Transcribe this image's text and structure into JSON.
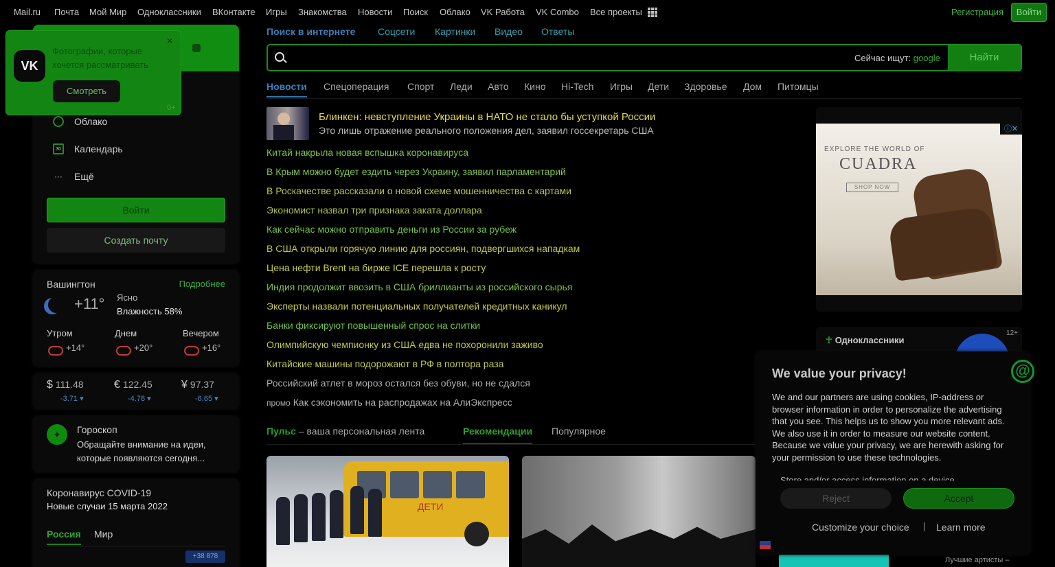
{
  "topnav": {
    "links": [
      "Mail.ru",
      "Почта",
      "Мой Мир",
      "Одноклассники",
      "ВКонтакте",
      "Игры",
      "Знакомства",
      "Новости",
      "Поиск",
      "Облако",
      "VK Работа",
      "VK Combo",
      "Все проекты"
    ],
    "register": "Регистрация",
    "login": "Войти"
  },
  "vk_popup": {
    "logo": "VK",
    "text": "Фотографии, которые хочется рассматривать",
    "button": "Смотреть",
    "age": "0+",
    "close": "×"
  },
  "mail": {
    "menu": [
      {
        "label": "Облако",
        "icon": "cloud-icon"
      },
      {
        "label": "Календарь",
        "icon": "calendar-icon",
        "icon_text": "30"
      },
      {
        "label": "Ещё",
        "icon": "more-icon",
        "icon_text": "···"
      }
    ],
    "login_button": "Войти",
    "create_button": "Создать почту"
  },
  "weather": {
    "city": "Вашингтон",
    "more": "Подробнее",
    "temp": "+11°",
    "condition": "Ясно",
    "humidity": "Влажность 58%",
    "parts": [
      {
        "label": "Утром",
        "temp": "+14°"
      },
      {
        "label": "Днем",
        "temp": "+20°"
      },
      {
        "label": "Вечером",
        "temp": "+16°"
      }
    ]
  },
  "currency": [
    {
      "symbol": "$",
      "value": "111.48",
      "delta": "-3.71"
    },
    {
      "symbol": "€",
      "value": "122.45",
      "delta": "-4.78"
    },
    {
      "symbol": "¥",
      "value": "97.37",
      "delta": "-6.65"
    }
  ],
  "horoscope": {
    "title": "Гороскоп",
    "text": "Обращайте внимание на идеи, которые появляются сегодня..."
  },
  "covid": {
    "title": "Коронавирус COVID-19",
    "subtitle": "Новые случаи 15 марта 2022",
    "tabs": [
      "Россия",
      "Мир"
    ],
    "badge": "+38 878"
  },
  "search": {
    "tabs": [
      "Поиск в интернете",
      "Соцсети",
      "Картинки",
      "Видео",
      "Ответы"
    ],
    "placeholder": "",
    "hint_label": "Сейчас ищут:",
    "hint_value": "google",
    "button": "Найти"
  },
  "categories": [
    "Новости",
    "Спецоперация",
    "Спорт",
    "Леди",
    "Авто",
    "Кино",
    "Hi-Tech",
    "Игры",
    "Дети",
    "Здоровье",
    "Дом",
    "Питомцы"
  ],
  "news": {
    "lead": {
      "title": "Блинкен: невступление Украины в НАТО не стало бы уступкой России",
      "subtitle": "Это лишь отражение реального положения дел, заявил госсекретарь США"
    },
    "items": [
      "Китай накрыла новая вспышка коронавируса",
      "В Крым можно будет ездить через Украину, заявил парламентарий",
      "В Роскачестве рассказали о новой схеме мошенничества с картами",
      "Экономист назвал три признака заката доллара",
      "Как сейчас можно отправить деньги из России за рубеж",
      "В США открыли горячую линию для россиян, подвергшихся нападкам",
      "Цена нефти Brent на бирже ICE перешла к росту",
      "Индия продолжит ввозить в США бриллианты из российского сырья",
      "Эксперты назвали потенциальных получателей кредитных каникул",
      "Банки фиксируют повышенный спрос на слитки",
      "Олимпийскую чемпионку из США едва не похоронили заживо",
      "Китайские машины подорожают в РФ в полтора раза",
      "Российский атлет в мороз остался без обуви, но не сдался"
    ],
    "promo_tag": "промо",
    "promo": "Как сэкономить на распродажах на АлиЭкспресс",
    "colors": [
      "#d6cf47",
      "#7ec24a",
      "#7ec24a",
      "#b6c84a",
      "#a8c04a",
      "#6fbf4a",
      "#c0c84a",
      "#c8cc48",
      "#7ec24a",
      "#c8c84a",
      "#6fbf4a",
      "#c0c84a",
      "#c0c84a",
      "#b0b0b0"
    ]
  },
  "pulse": {
    "brand": "Пульс",
    "tagline": " – ваша персональная лента",
    "tabs": [
      "Рекомендации",
      "Популярное"
    ]
  },
  "bus_sign": "ДЕТИ",
  "ad": {
    "top_text": "EXPLORE THE WORLD OF",
    "brand": "CUADRA",
    "shop": "SHOP NOW"
  },
  "ok": {
    "label": "Одноклассники",
    "age": "12+"
  },
  "privacy": {
    "title": "We value your privacy!",
    "body": "We and our partners are using cookies, IP-address or browser information in order to personalize the advertising that you see. This helps us to show you more relevant ads. We also use it in order to measure our website content. Because we value your privacy, we are herewith asking for your permission to use these technologies.",
    "cut_text": "Store and/or access information on a device",
    "reject": "Reject",
    "accept": "Accept",
    "customize": "Customize your choice",
    "separator": "|",
    "learn": "Learn more"
  },
  "bottom_text": "Лучшие артисты –"
}
